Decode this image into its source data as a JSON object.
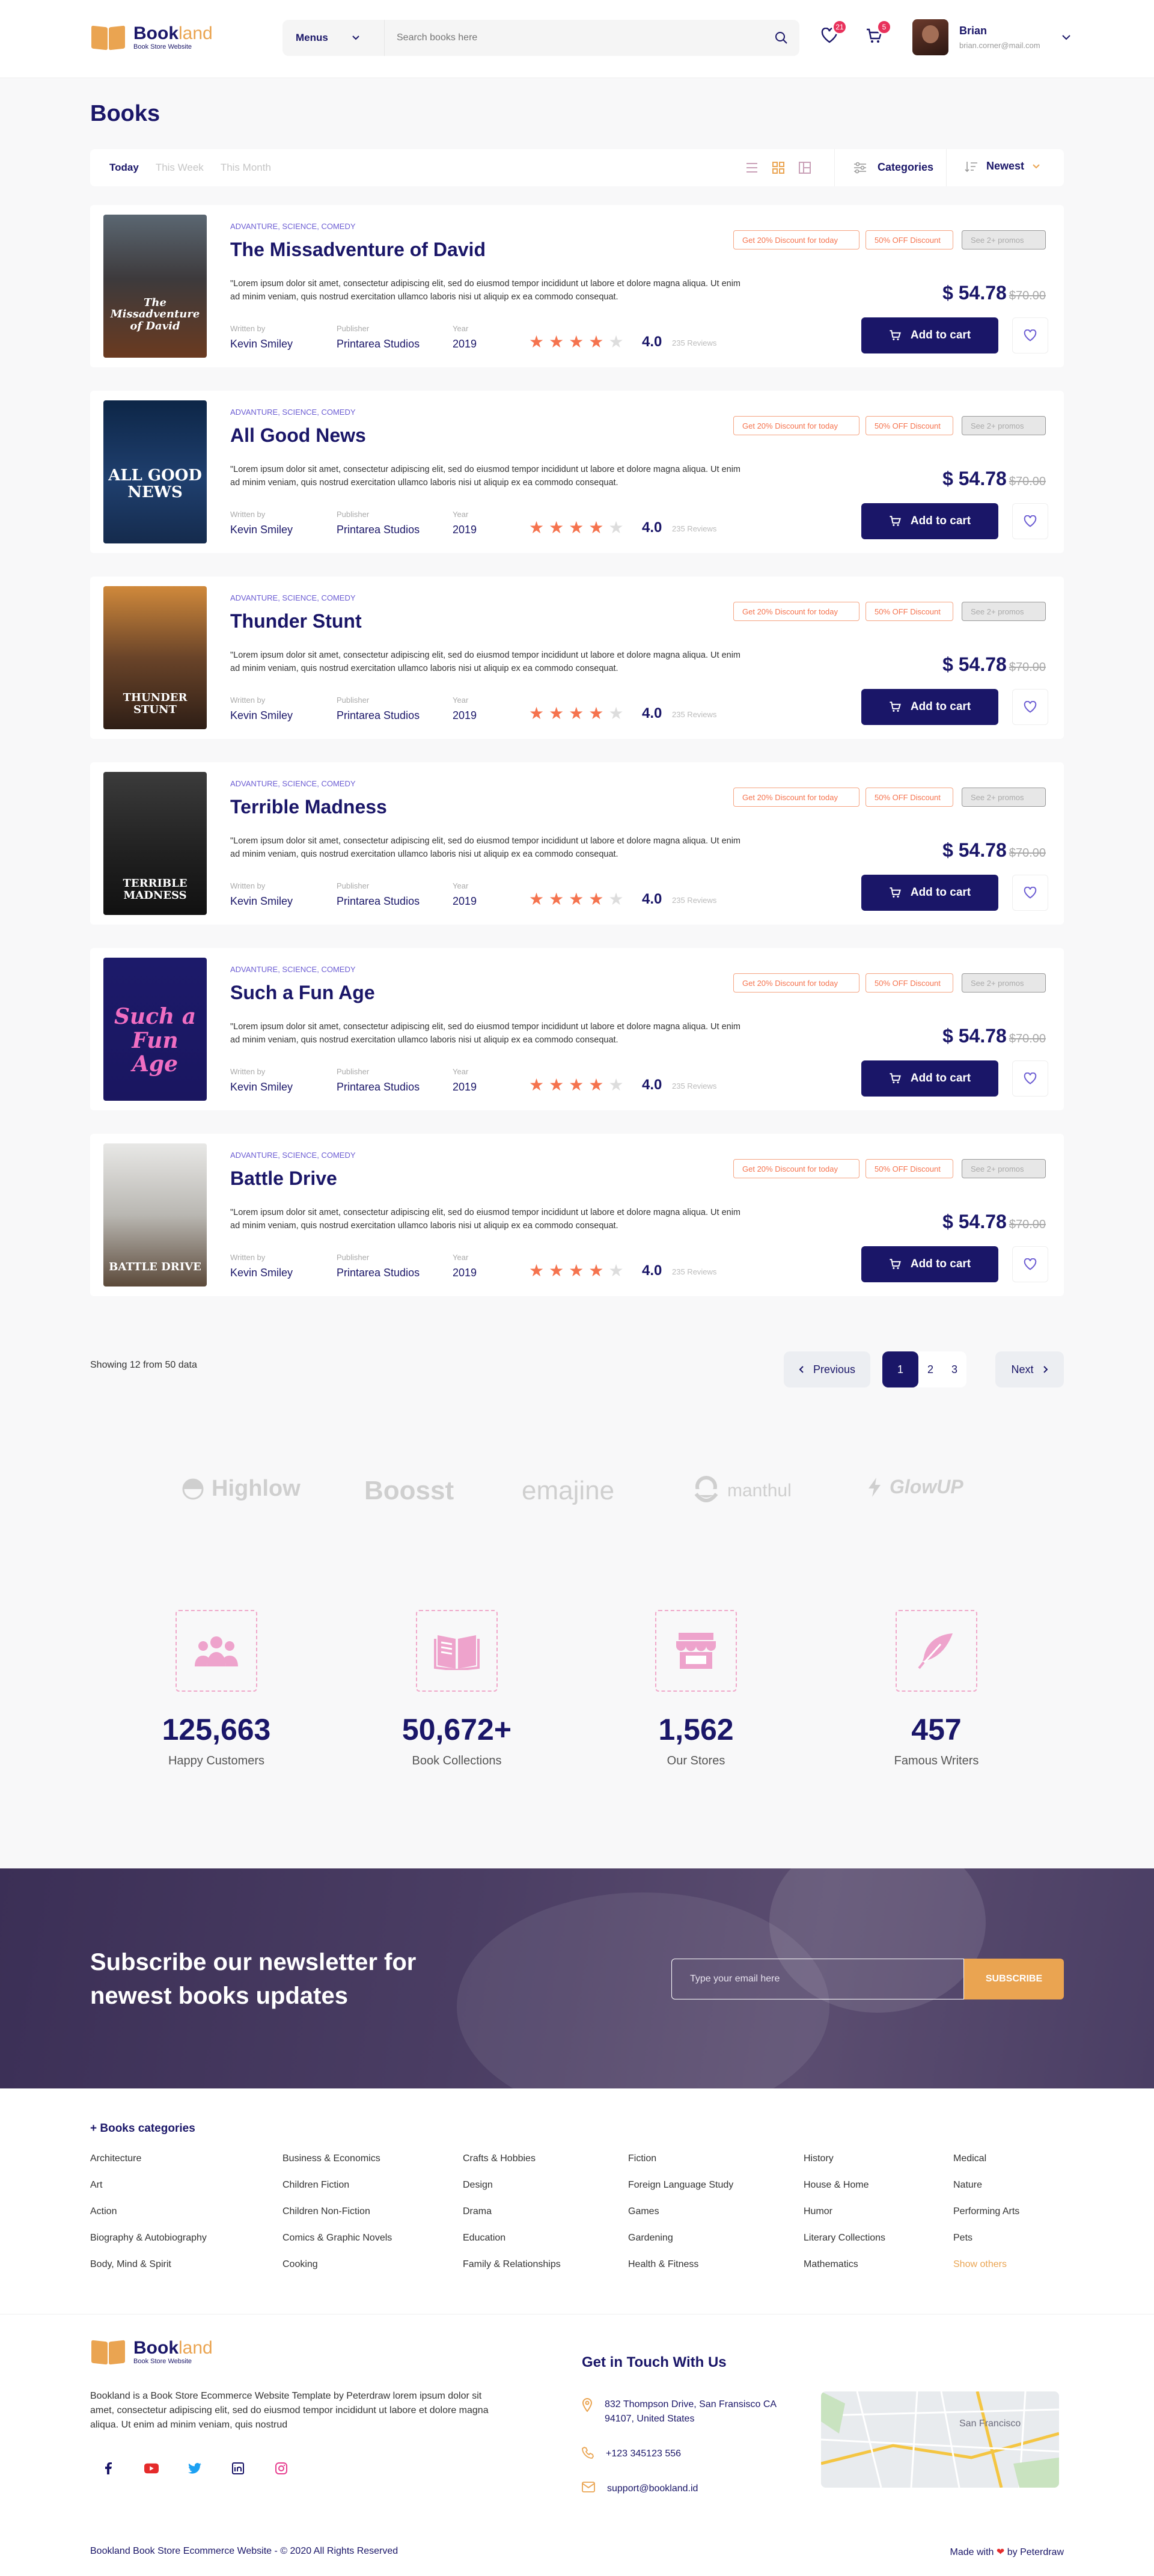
{
  "brand": {
    "name_a": "Book",
    "name_b": "land",
    "tagline": "Book Store Website"
  },
  "header": {
    "menus_label": "Menus",
    "search_placeholder": "Search books here",
    "wishlist_count": "21",
    "cart_count": "5",
    "user_name": "Brian",
    "user_email": "brian.corner@mail.com"
  },
  "page_title": "Books",
  "filters": {
    "tabs": [
      "Today",
      "This Week",
      "This Month"
    ],
    "categories_label": "Categories",
    "sort_label": "Newest"
  },
  "book_labels": {
    "written_by": "Written by",
    "publisher": "Publisher",
    "year": "Year",
    "add_to_cart": "Add to cart",
    "reviews_suffix": "235 Reviews"
  },
  "colors": {
    "primary": "#1a1668",
    "accent": "#eaa451",
    "star": "#f5734e",
    "badge": "#e8315b"
  },
  "books": [
    {
      "cover_text": "The Missadventure of David",
      "cover_bg": "linear-gradient(180deg,#5b6772 0%,#3d3a3c 45%,#6a3a20 100%)",
      "genre": "ADVANTURE, SCIENCE, COMEDY",
      "title": "The Missadventure of David",
      "desc": "\"Lorem ipsum dolor sit amet, consectetur adipiscing elit, sed do eiusmod tempor incididunt ut labore et dolore magna aliqua. Ut enim ad minim veniam, quis nostrud exercitation ullamco laboris nisi ut aliquip ex ea commodo consequat.",
      "author": "Kevin Smiley",
      "publisher": "Printarea Studios",
      "year": "2019",
      "stars": 4,
      "rating": "4.0",
      "reviews": "235 Reviews",
      "promos": [
        "Get 20% Discount for today",
        "50% OFF Discount",
        "See 2+ promos"
      ],
      "price": "$ 54.78",
      "old_price": "$70.00"
    },
    {
      "cover_text": "ALL GOOD NEWS",
      "cover_bg": "linear-gradient(180deg,#0d2647 0%,#1f3f6e 55%,#152b4d 100%)",
      "genre": "ADVANTURE, SCIENCE, COMEDY",
      "title": "All Good News",
      "desc": "\"Lorem ipsum dolor sit amet, consectetur adipiscing elit, sed do eiusmod tempor incididunt ut labore et dolore magna aliqua. Ut enim ad minim veniam, quis nostrud exercitation ullamco laboris nisi ut aliquip ex ea commodo consequat.",
      "author": "Kevin Smiley",
      "publisher": "Printarea Studios",
      "year": "2019",
      "stars": 4,
      "rating": "4.0",
      "reviews": "235 Reviews",
      "promos": [
        "Get 20% Discount for today",
        "50% OFF Discount",
        "See 2+ promos"
      ],
      "price": "$ 54.78",
      "old_price": "$70.00"
    },
    {
      "cover_text": "THUNDER STUNT",
      "cover_bg": "linear-gradient(180deg,#d0893b 0%,#6a4429 50%,#2e1e16 100%)",
      "genre": "ADVANTURE, SCIENCE, COMEDY",
      "title": "Thunder Stunt",
      "desc": "\"Lorem ipsum dolor sit amet, consectetur adipiscing elit, sed do eiusmod tempor incididunt ut labore et dolore magna aliqua. Ut enim ad minim veniam, quis nostrud exercitation ullamco laboris nisi ut aliquip ex ea commodo consequat.",
      "author": "Kevin Smiley",
      "publisher": "Printarea Studios",
      "year": "2019",
      "stars": 4,
      "rating": "4.0",
      "reviews": "235 Reviews",
      "promos": [
        "Get 20% Discount for today",
        "50% OFF Discount",
        "See 2+ promos"
      ],
      "price": "$ 54.78",
      "old_price": "$70.00"
    },
    {
      "cover_text": "TERRIBLE MADNESS",
      "cover_bg": "linear-gradient(180deg,#3b3b3b 0%,#1f1f1f 60%,#111 100%)",
      "genre": "ADVANTURE, SCIENCE, COMEDY",
      "title": "Terrible Madness",
      "desc": "\"Lorem ipsum dolor sit amet, consectetur adipiscing elit, sed do eiusmod tempor incididunt ut labore et dolore magna aliqua. Ut enim ad minim veniam, quis nostrud exercitation ullamco laboris nisi ut aliquip ex ea commodo consequat.",
      "author": "Kevin Smiley",
      "publisher": "Printarea Studios",
      "year": "2019",
      "stars": 4,
      "rating": "4.0",
      "reviews": "235 Reviews",
      "promos": [
        "Get 20% Discount for today",
        "50% OFF Discount",
        "See 2+ promos"
      ],
      "price": "$ 54.78",
      "old_price": "$70.00"
    },
    {
      "cover_text": "Such a Fun Age",
      "cover_bg": "linear-gradient(180deg,#1c1a6a 0%,#1a1660 100%)",
      "genre": "ADVANTURE, SCIENCE, COMEDY",
      "title": "Such a Fun Age",
      "desc": "\"Lorem ipsum dolor sit amet, consectetur adipiscing elit, sed do eiusmod tempor incididunt ut labore et dolore magna aliqua. Ut enim ad minim veniam, quis nostrud exercitation ullamco laboris nisi ut aliquip ex ea commodo consequat.",
      "author": "Kevin Smiley",
      "publisher": "Printarea Studios",
      "year": "2019",
      "stars": 4,
      "rating": "4.0",
      "reviews": "235 Reviews",
      "promos": [
        "Get 20% Discount for today",
        "50% OFF Discount",
        "See 2+ promos"
      ],
      "price": "$ 54.78",
      "old_price": "$70.00"
    },
    {
      "cover_text": "BATTLE DRIVE",
      "cover_bg": "linear-gradient(180deg,#e8e8e6 0%,#b9b7b2 50%,#5c4a3a 100%)",
      "genre": "ADVANTURE, SCIENCE, COMEDY",
      "title": "Battle Drive",
      "desc": "\"Lorem ipsum dolor sit amet, consectetur adipiscing elit, sed do eiusmod tempor incididunt ut labore et dolore magna aliqua. Ut enim ad minim veniam, quis nostrud exercitation ullamco laboris nisi ut aliquip ex ea commodo consequat.",
      "author": "Kevin Smiley",
      "publisher": "Printarea Studios",
      "year": "2019",
      "stars": 4,
      "rating": "4.0",
      "reviews": "235 Reviews",
      "promos": [
        "Get 20% Discount for today",
        "50% OFF Discount",
        "See 2+ promos"
      ],
      "price": "$ 54.78",
      "old_price": "$70.00"
    }
  ],
  "pagination": {
    "showing": "Showing 12 from 50 data",
    "previous": "Previous",
    "next": "Next",
    "pages": [
      "1",
      "2",
      "3"
    ],
    "current": "1"
  },
  "brands": [
    "Highlow",
    "Boosst",
    "emajine",
    "manthul",
    "GlowUP"
  ],
  "stats": [
    {
      "icon": "users-icon",
      "value": "125,663",
      "label": "Happy Customers"
    },
    {
      "icon": "book-icon",
      "value": "50,672+",
      "label": "Book Collections"
    },
    {
      "icon": "store-icon",
      "value": "1,562",
      "label": "Our Stores"
    },
    {
      "icon": "feather-icon",
      "value": "457",
      "label": "Famous Writers"
    }
  ],
  "newsletter": {
    "title_line1": "Subscribe our newsletter for",
    "title_line2": "newest books updates",
    "placeholder": "Type your email here",
    "button": "SUBSCRIBE"
  },
  "categories": {
    "title": "+ Books categories",
    "columns": [
      [
        "Architecture",
        "Art",
        "Action",
        "Biography & Autobiography",
        "Body, Mind & Spirit"
      ],
      [
        "Business & Economics",
        "Children Fiction",
        "Children Non-Fiction",
        "Comics & Graphic Novels",
        "Cooking"
      ],
      [
        "Crafts & Hobbies",
        "Design",
        "Drama",
        "Education",
        "Family & Relationships"
      ],
      [
        "Fiction",
        "Foreign Language Study",
        "Games",
        "Gardening",
        "Health & Fitness"
      ],
      [
        "History",
        "House & Home",
        "Humor",
        "Literary Collections",
        "Mathematics"
      ],
      [
        "Medical",
        "Nature",
        "Performing Arts",
        "Pets",
        "Show others"
      ]
    ]
  },
  "footer": {
    "description": "Bookland is a Book Store Ecommerce Website Template by Peterdraw lorem ipsum dolor sit amet, consectetur adipiscing elit, sed do eiusmod tempor incididunt ut labore et dolore magna aliqua. Ut enim ad minim veniam, quis nostrud",
    "contact_title": "Get in Touch With Us",
    "address": "832  Thompson Drive, San Fransisco CA 94107, United States",
    "phone": "+123 345123 556",
    "email": "support@bookland.id",
    "copyright": "Bookland Book Store Ecommerce Website - © 2020 All Rights Reserved",
    "made_with_a": "Made with",
    "made_with_b": "by Peterdraw",
    "map_label": "San Francisco"
  }
}
